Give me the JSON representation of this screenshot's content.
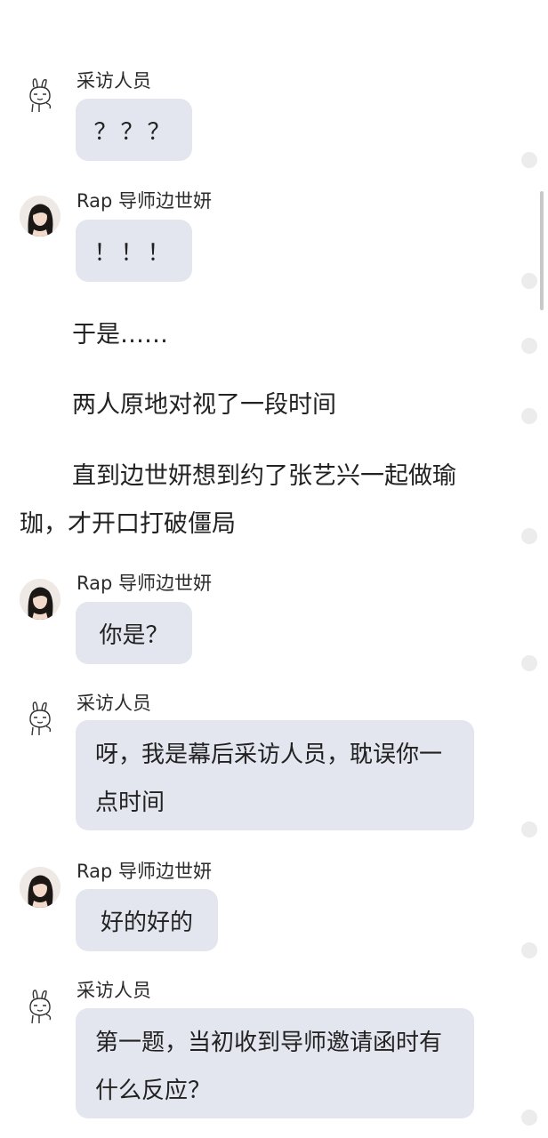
{
  "messages": [
    {
      "sender": "采访人员",
      "text": "？？？"
    },
    {
      "sender": "Rap 导师边世妍",
      "text": "！！！"
    },
    {
      "sender": "Rap 导师边世妍",
      "text": "你是？"
    },
    {
      "sender": "采访人员",
      "text": "呀，我是幕后采访人员，耽误你一点时间"
    },
    {
      "sender": "Rap 导师边世妍",
      "text": "好的好的"
    },
    {
      "sender": "采访人员",
      "text": "第一题，当初收到导师邀请函时有什么反应？"
    }
  ],
  "narration": {
    "line1": "于是……",
    "line2": "两人原地对视了一段时间",
    "line3a": "直到边世妍想到约了张艺兴一起做瑜",
    "line3b": "珈，才开口打破僵局"
  },
  "colors": {
    "bubble": "#e3e6ef",
    "text": "#222222",
    "side_dot": "#ececec",
    "scrollbar": "#c9c9c9"
  }
}
